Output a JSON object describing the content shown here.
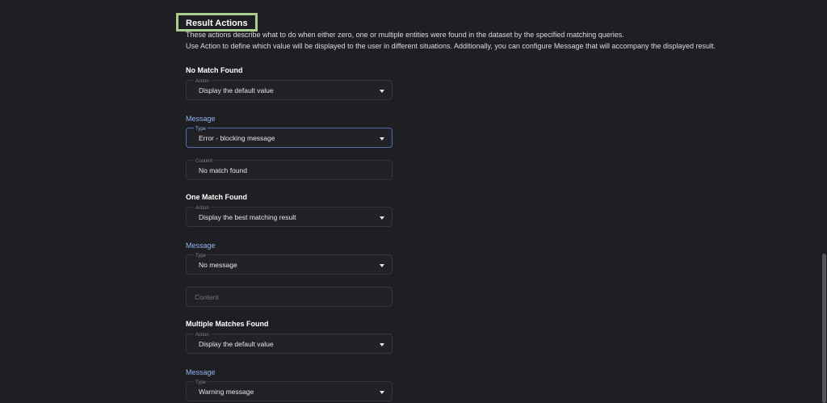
{
  "header": {
    "title": "Result Actions",
    "description_line1": "These actions describe what to do when either zero, one or multiple entities were found in the dataset by the specified matching queries.",
    "description_line2": "Use Action to define which value will be displayed to the user in different situations. Additionally, you can configure Message that will accompany the displayed result."
  },
  "labels": {
    "action": "Action",
    "message": "Message",
    "type": "Type",
    "content": "Content"
  },
  "no_match": {
    "heading": "No Match Found",
    "action_value": "Display the default value",
    "message_type_value": "Error - blocking message",
    "content_value": "No match found"
  },
  "one_match": {
    "heading": "One Match Found",
    "action_value": "Display the best matching result",
    "message_type_value": "No message",
    "content_placeholder": "Content"
  },
  "multiple_matches": {
    "heading": "Multiple Matches Found",
    "action_value": "Display the default value",
    "message_type_value": "Warning message"
  }
}
